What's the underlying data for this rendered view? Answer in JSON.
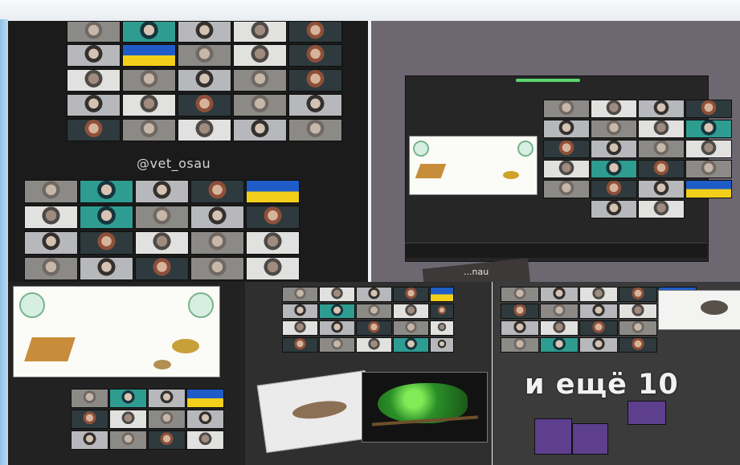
{
  "collage": {
    "watermark": "@vet_osau",
    "watermark_secondary": "...nau",
    "overlay_text": "и ещё 10"
  },
  "icons": {
    "logo": "university-logo-icon",
    "giraffe": "giraffe-icon",
    "turtle": "turtle-icon",
    "chameleon": "chameleon-icon"
  },
  "colors": {
    "ukraine_blue": "#1f5cc8",
    "ukraine_yellow": "#f2cf1b",
    "accent_green": "#5bd56f"
  }
}
